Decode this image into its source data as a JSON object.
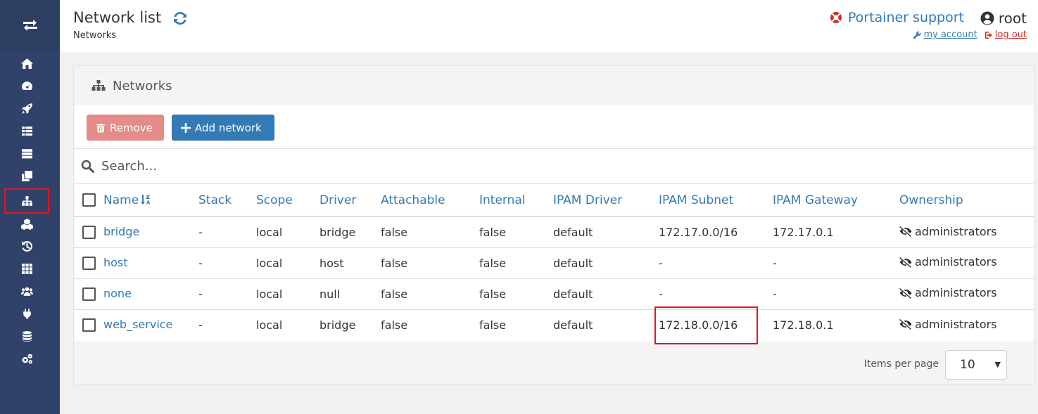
{
  "header": {
    "title": "Network list",
    "breadcrumb": "Networks",
    "support_label": "Portainer support",
    "username": "root",
    "my_account_label": " my account ",
    "logout_label": " log out"
  },
  "sidebar": {
    "items": [
      {
        "icon": "home-icon"
      },
      {
        "icon": "dashboard-icon"
      },
      {
        "icon": "rocket-icon"
      },
      {
        "icon": "th-list-icon"
      },
      {
        "icon": "server-icon"
      },
      {
        "icon": "clone-icon"
      },
      {
        "icon": "sitemap-icon",
        "active": true
      },
      {
        "icon": "cubes-icon"
      },
      {
        "icon": "history-icon"
      },
      {
        "icon": "th-icon"
      },
      {
        "icon": "users-icon"
      },
      {
        "icon": "plug-icon"
      },
      {
        "icon": "database-icon"
      },
      {
        "icon": "cogs-icon"
      }
    ]
  },
  "widget": {
    "title": "Networks",
    "remove_label": "Remove",
    "add_label": "Add network",
    "search_placeholder": "Search..."
  },
  "table": {
    "columns": [
      "Name",
      "Stack",
      "Scope",
      "Driver",
      "Attachable",
      "Internal",
      "IPAM Driver",
      "IPAM Subnet",
      "IPAM Gateway",
      "Ownership"
    ],
    "rows": [
      [
        "bridge",
        "-",
        "local",
        "bridge",
        "false",
        "false",
        "default",
        "172.17.0.0/16",
        "172.17.0.1",
        "administrators"
      ],
      [
        "host",
        "-",
        "local",
        "host",
        "false",
        "false",
        "default",
        "-",
        "-",
        "administrators"
      ],
      [
        "none",
        "-",
        "local",
        "null",
        "false",
        "false",
        "default",
        "-",
        "-",
        "administrators"
      ],
      [
        "web_service",
        "-",
        "local",
        "bridge",
        "false",
        "false",
        "default",
        "172.18.0.0/16",
        "172.18.0.1",
        "administrators"
      ]
    ]
  },
  "pagination": {
    "items_per_page_label": "Items per page",
    "items_per_page_value": "10"
  },
  "colors": {
    "sidebar": "#30426a",
    "primary": "#337ab7",
    "danger_light": "#e58b89",
    "highlight": "#e0161d"
  }
}
